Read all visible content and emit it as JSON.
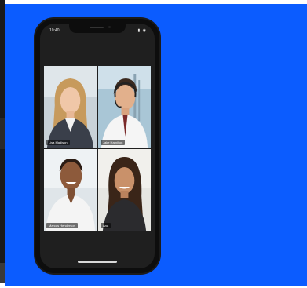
{
  "status_bar": {
    "time": "10:40",
    "icons": "▮ ◉"
  },
  "participants": [
    {
      "name": "Lisa Madison",
      "active": false
    },
    {
      "name": "Jake Hamilton",
      "active": true
    },
    {
      "name": "Marcus Henderson",
      "active": false
    },
    {
      "name": "Ana",
      "active": false
    }
  ],
  "colors": {
    "background": "#0b5cff",
    "phone": "#0d0d0d",
    "screen": "#1f1f1f",
    "active_speaker": "#f2d24a"
  }
}
